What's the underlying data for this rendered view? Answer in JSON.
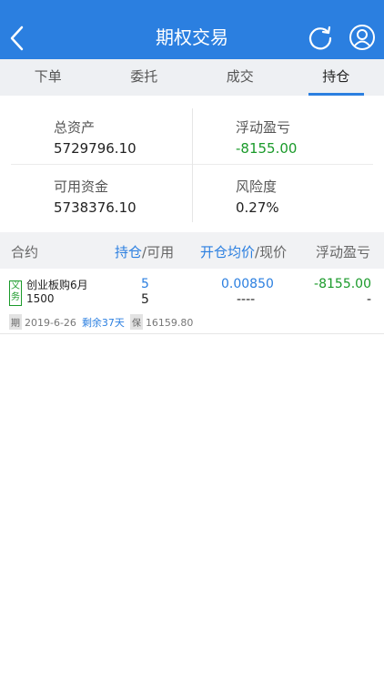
{
  "header": {
    "title": "期权交易"
  },
  "tabs": [
    {
      "label": "下单"
    },
    {
      "label": "委托"
    },
    {
      "label": "成交"
    },
    {
      "label": "持仓"
    }
  ],
  "summary": {
    "total_assets_label": "总资产",
    "total_assets_value": "5729796.10",
    "floating_pl_label": "浮动盈亏",
    "floating_pl_value": "-8155.00",
    "available_funds_label": "可用资金",
    "available_funds_value": "5738376.10",
    "risk_label": "风险度",
    "risk_value": "0.27%"
  },
  "list_header": {
    "contract": "合约",
    "position": "持仓",
    "available": "/可用",
    "open_avg": "开仓均价",
    "current_price": "/现价",
    "floating_pl": "浮动盈亏"
  },
  "rows": [
    {
      "tag": "义务",
      "name_line1": "创业板购6月",
      "name_line2": "1500",
      "position": "5",
      "available": "5",
      "open_avg": "0.00850",
      "current_price": "----",
      "floating_pl": "-8155.00",
      "floating_pl_2": "-",
      "period_badge": "期",
      "expiry": "2019-6-26",
      "remaining": "剩余37天",
      "margin_badge": "保",
      "margin": "16159.80"
    }
  ],
  "colors": {
    "header_blue": "#2b7fe0",
    "loss_green": "#1a9a2a"
  }
}
